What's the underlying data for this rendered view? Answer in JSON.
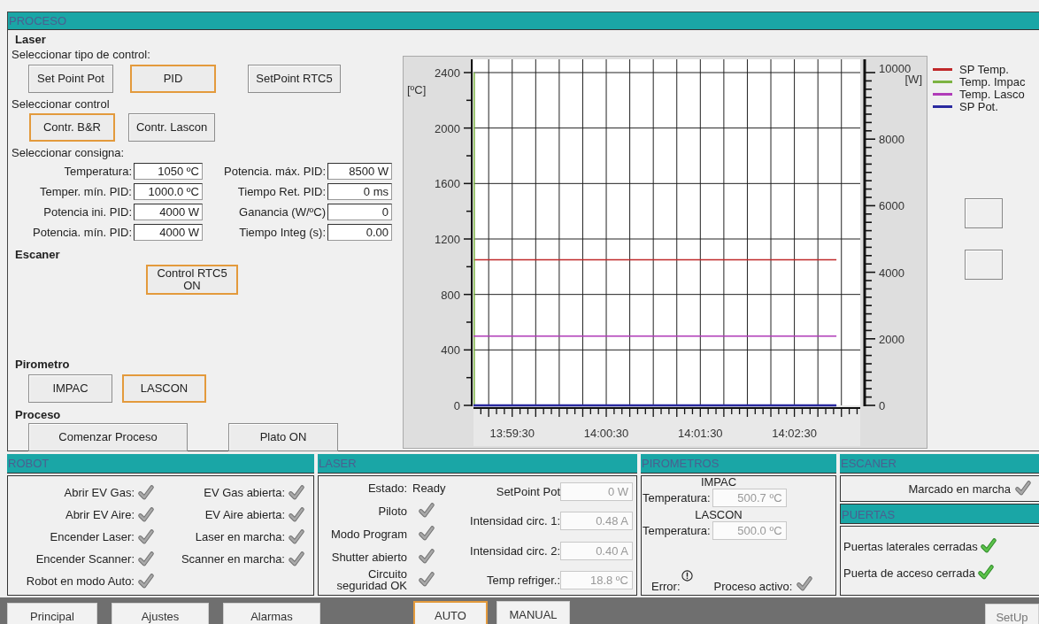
{
  "proceso": {
    "title": "PROCESO",
    "laser": {
      "title": "Laser",
      "control_type": {
        "label": "Seleccionar tipo de control:",
        "options": [
          {
            "label": "Set Point Pot",
            "selected": false
          },
          {
            "label": "PID",
            "selected": true
          },
          {
            "label": "SetPoint RTC5",
            "selected": false
          }
        ]
      },
      "control": {
        "label": "Seleccionar control",
        "options": [
          {
            "label": "Contr. B&R",
            "selected": true
          },
          {
            "label": "Contr. Lascon",
            "selected": false
          }
        ]
      },
      "setpoints": {
        "label": "Seleccionar consigna:",
        "fields": [
          {
            "label": "Temperatura:",
            "value": "1050 ºC"
          },
          {
            "label": "Potencia. máx. PID:",
            "value": "8500 W"
          },
          {
            "label": "Temper. mín. PID:",
            "value": "1000.0 ºC"
          },
          {
            "label": "Tiempo Ret. PID:",
            "value": "0 ms"
          },
          {
            "label": "Potencia ini. PID:",
            "value": "4000 W"
          },
          {
            "label": "Ganancia (W/ºC)",
            "value": "0"
          },
          {
            "label": "Potencia. mín. PID:",
            "value": "4000 W"
          },
          {
            "label": "Tiempo Integ (s):",
            "value": "0.00"
          }
        ]
      }
    },
    "escaner": {
      "title": "Escaner",
      "options": [
        {
          "label": "Control RTC5 ON",
          "selected": true
        }
      ]
    },
    "pirometro": {
      "title": "Pirometro",
      "options": [
        {
          "label": "IMPAC",
          "selected": false
        },
        {
          "label": "LASCON",
          "selected": true
        }
      ]
    },
    "acciones": {
      "title": "Proceso",
      "buttons": [
        "Comenzar Proceso",
        "Plato ON"
      ]
    },
    "chart": {
      "chart_data": {
        "type": "line",
        "ylabel": "[ºC]",
        "ylim": [
          0,
          2400
        ],
        "yticks": [
          0,
          400,
          800,
          1200,
          1600,
          2000,
          2400
        ],
        "y2label": "[W]",
        "y2lim": [
          0,
          10000
        ],
        "y2ticks": [
          0,
          2000,
          4000,
          6000,
          8000,
          10000
        ],
        "grid": true,
        "xlim": [
          50345.3,
          50592
        ],
        "xticks": [
          {
            "value": 50370,
            "label": "13:59:30"
          },
          {
            "value": 50430,
            "label": "14:00:30"
          },
          {
            "value": 50490,
            "label": "14:01:30"
          },
          {
            "value": 50550,
            "label": "14:02:30"
          }
        ],
        "series": [
          {
            "name": "SP Temp.",
            "color": "#c0282a",
            "x": [
              50345.3,
              50576.8
            ],
            "values": [
              1050,
              1050
            ]
          },
          {
            "name": "Temp. Impac",
            "color": "#7cb342",
            "x": [
              50345.8,
              50345.8
            ],
            "values": [
              0,
              2400
            ]
          },
          {
            "name": "Temp. Lasco",
            "color": "#b03cb8",
            "x": [
              50345.3,
              50576.8
            ],
            "values": [
              500,
              500
            ]
          },
          {
            "name": "SP Pot.",
            "color": "#2a2aa0",
            "axis": "y2",
            "x": [
              50345.3,
              50576.8
            ],
            "values": [
              0,
              0
            ]
          }
        ]
      }
    }
  },
  "robot": {
    "title": "ROBOT",
    "signals": [
      {
        "label": "Abrir EV Gas:",
        "lit": false
      },
      {
        "label": "EV Gas abierta:",
        "lit": false
      },
      {
        "label": "Abrir EV Aire:",
        "lit": false
      },
      {
        "label": "EV Aire abierta:",
        "lit": false
      },
      {
        "label": "Encender Laser:",
        "lit": false
      },
      {
        "label": "Laser en marcha:",
        "lit": false
      },
      {
        "label": "Encender Scanner:",
        "lit": false
      },
      {
        "label": "Scanner en marcha:",
        "lit": false
      },
      {
        "label": "Robot en modo Auto:",
        "lit": false
      }
    ]
  },
  "laser_status": {
    "title": "LASER",
    "estado": {
      "label": "Estado:",
      "value": "Ready"
    },
    "signals": [
      {
        "label": "Piloto",
        "lit": false
      },
      {
        "label": "Modo Program",
        "lit": false
      },
      {
        "label": "Shutter abierto",
        "lit": false
      },
      {
        "label": "Circuito seguridad OK",
        "lit": false
      }
    ],
    "readings": [
      {
        "label": "SetPoint Pot",
        "value": "0 W",
        "disabled": true
      },
      {
        "label": "Intensidad circ. 1:",
        "value": "0.48 A",
        "disabled": true
      },
      {
        "label": "Intensidad circ. 2:",
        "value": "0.40 A",
        "disabled": true
      },
      {
        "label": "Temp refriger.:",
        "value": "18.8 ºC",
        "disabled": true
      }
    ]
  },
  "pirometros": {
    "title": "PIROMETROS",
    "sensors": [
      {
        "name": "IMPAC",
        "label": "Temperatura:",
        "value": "500.7 ºC",
        "disabled": true
      },
      {
        "name": "LASCON",
        "label": "Temperatura:",
        "value": "500.0 ºC",
        "disabled": true
      }
    ],
    "error": {
      "label": "Error:"
    },
    "process_active": {
      "label": "Proceso activo:",
      "lit": false
    }
  },
  "escaner_status": {
    "title": "ESCANER",
    "signals": [
      {
        "label": "Marcado en marcha",
        "lit": false
      }
    ]
  },
  "puertas": {
    "title": "PUERTAS",
    "signals": [
      {
        "label": "Puertas laterales cerradas",
        "lit": true
      },
      {
        "label": "Puerta de acceso cerrada",
        "lit": true
      }
    ]
  },
  "footer": {
    "nav": [
      "Principal",
      "Ajustes",
      "Alarmas"
    ],
    "modes": [
      {
        "label": "AUTO",
        "selected": true
      },
      {
        "label": "MANUAL",
        "selected": false
      }
    ],
    "setup": "SetUp"
  }
}
